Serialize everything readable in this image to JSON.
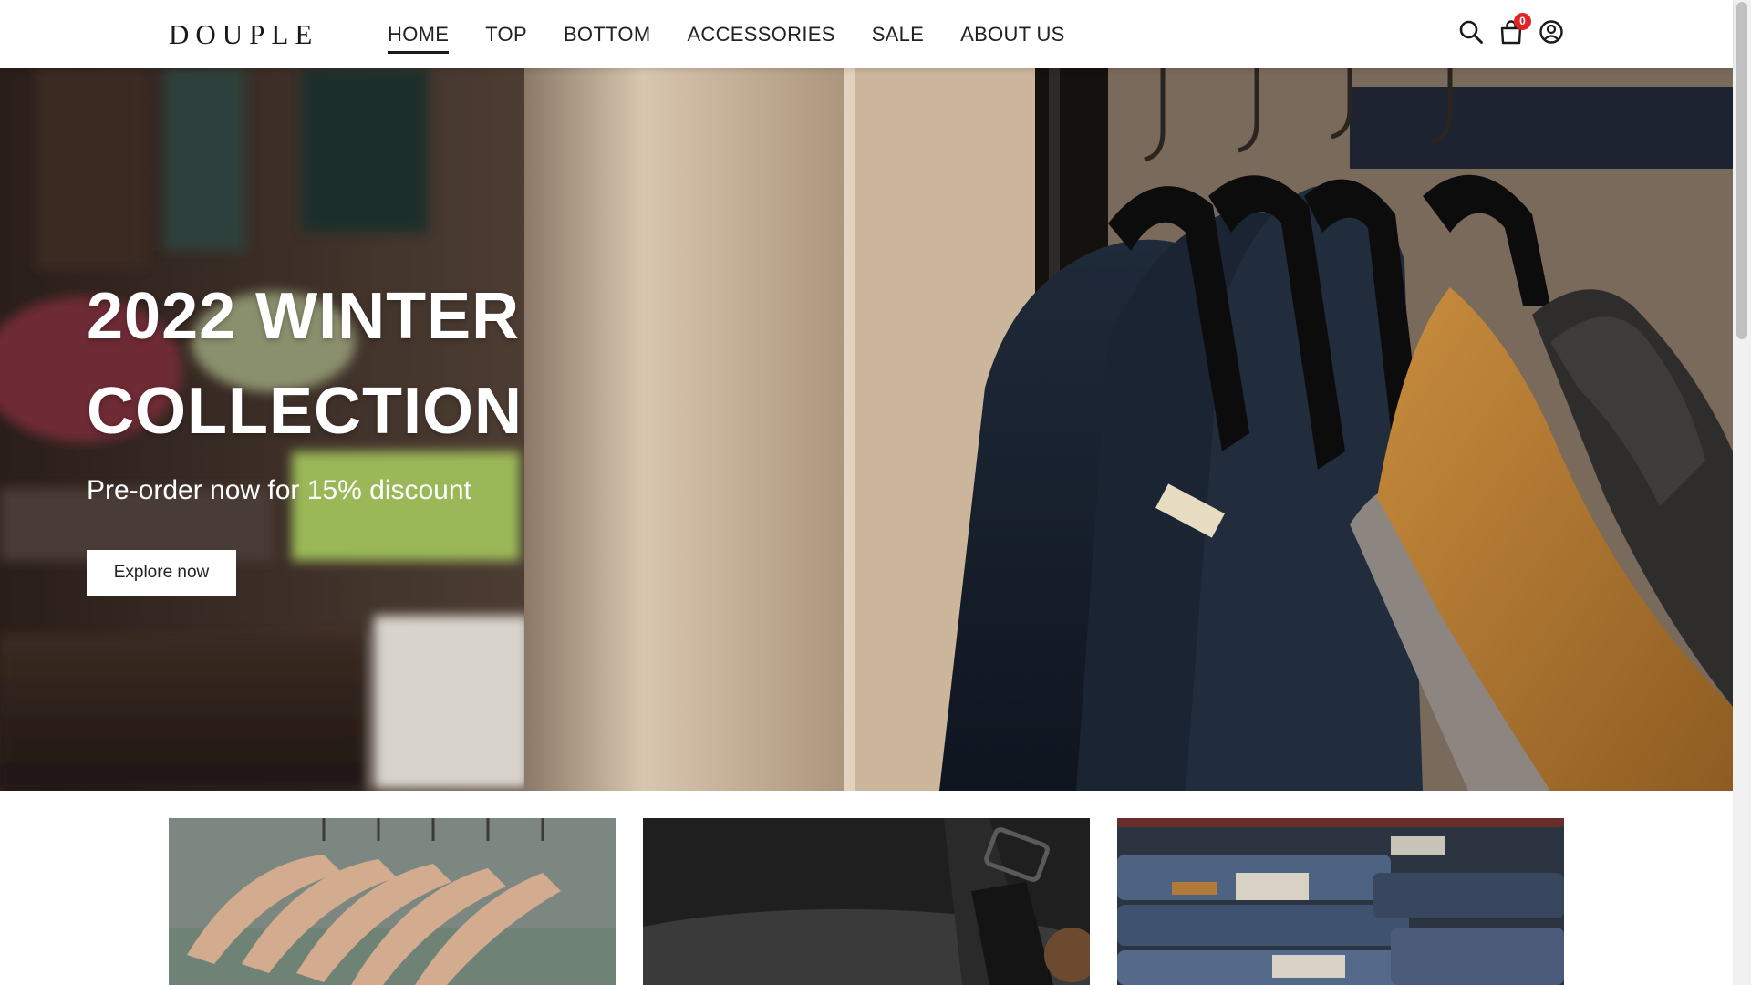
{
  "brand": {
    "logo": "DOUPLE"
  },
  "nav": {
    "items": [
      {
        "label": "HOME",
        "active": true
      },
      {
        "label": "TOP",
        "active": false
      },
      {
        "label": "BOTTOM",
        "active": false
      },
      {
        "label": "ACCESSORIES",
        "active": false
      },
      {
        "label": "SALE",
        "active": false
      },
      {
        "label": "ABOUT US",
        "active": false
      }
    ]
  },
  "header_icons": {
    "search": "search-icon",
    "cart": "shopping-bag-icon",
    "cart_count": "0",
    "account": "user-circle-icon"
  },
  "hero": {
    "title_line1": "2022 WINTER",
    "title_line2": "COLLECTION",
    "subtitle": "Pre-order now for 15% discount",
    "button_label": "Explore now"
  },
  "categories": [
    {
      "image": "hangers-with-shirts"
    },
    {
      "image": "watch-on-dark-fabric"
    },
    {
      "image": "stacked-jeans"
    }
  ],
  "colors": {
    "badge": "#e02424",
    "text_dark": "#222222",
    "hero_text": "#ffffff"
  }
}
